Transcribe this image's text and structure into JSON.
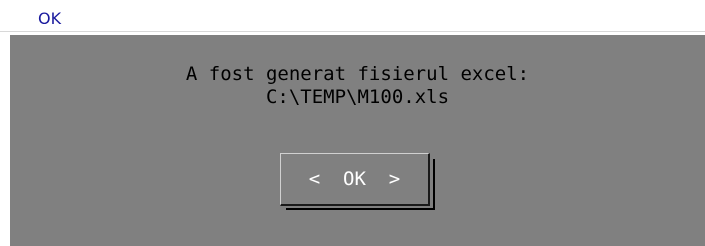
{
  "window": {
    "title": "OK"
  },
  "dialog": {
    "message_line1": "A fost generat fisierul excel:",
    "message_line2": "C:\\TEMP\\M100.xls",
    "ok_button_label": "<  OK  >"
  },
  "colors": {
    "title_text": "#1a1a9e",
    "dialog_background": "#808080",
    "message_text": "#000000",
    "button_text": "#ffffff"
  }
}
